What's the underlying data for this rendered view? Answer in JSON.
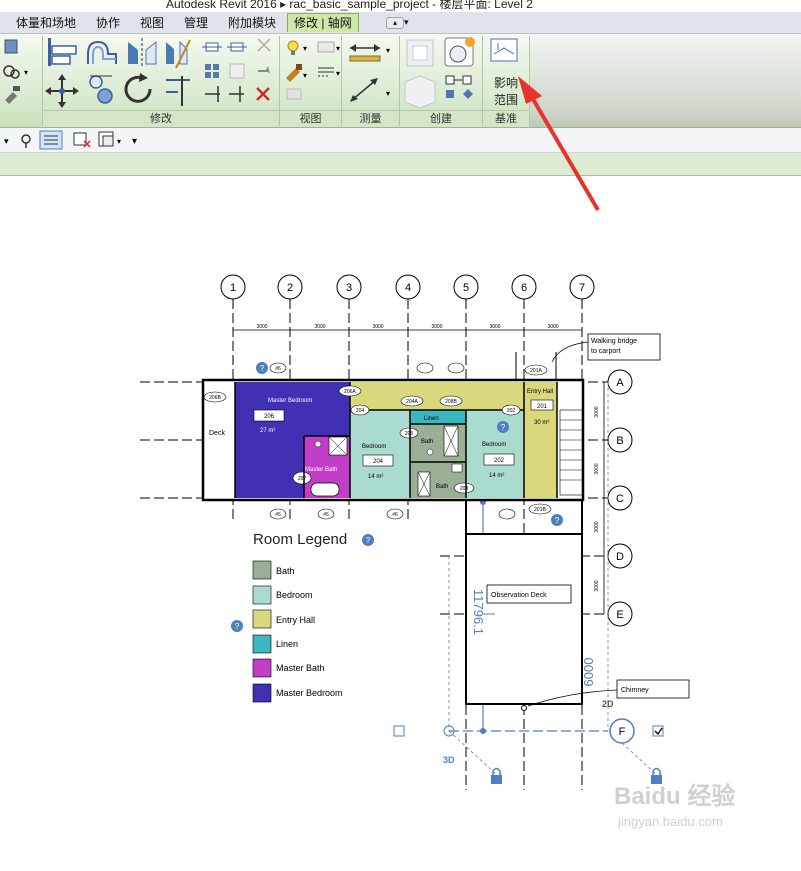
{
  "app": {
    "title": "Autodesk Revit 2016 ▸   rac_basic_sample_project - 楼层平面: Level 2"
  },
  "ribbon": {
    "tabs": [
      {
        "label": "体量和场地"
      },
      {
        "label": "协作"
      },
      {
        "label": "视图"
      },
      {
        "label": "管理"
      },
      {
        "label": "附加模块"
      },
      {
        "label": "修改 | 轴网"
      }
    ],
    "panels": {
      "modify": "修改",
      "view": "视图",
      "measure": "测量",
      "create": "创建",
      "datum": "基准"
    },
    "scope_box_label_line1": "影响",
    "scope_box_label_line2": "范围"
  },
  "plan": {
    "grid_columns": [
      "1",
      "2",
      "3",
      "4",
      "5",
      "6",
      "7"
    ],
    "grid_rows": [
      "A",
      "B",
      "C",
      "D",
      "E",
      "F"
    ],
    "spacing_h": [
      "3000",
      "3000",
      "3000",
      "3000",
      "3000",
      "3000"
    ],
    "spacing_v": [
      "3000",
      "3000",
      "3000",
      "3000"
    ],
    "dim_vertical": "11796.1",
    "dim_6000": "6000",
    "label_2d": "2D",
    "label_3d": "3D",
    "callouts": {
      "walking_bridge_line1": "Walking bridge",
      "walking_bridge_line2": "to carport",
      "chimney": "Chimney",
      "observation_deck": "Observation Deck"
    },
    "rooms": {
      "master_bedroom": {
        "name": "Master Bedroom",
        "number": "206",
        "area": "27 m²"
      },
      "master_bath": {
        "name": "Master Bath",
        "number": "207"
      },
      "bedroom_204": {
        "name": "Bedroom",
        "number": "204",
        "area": "14 m²"
      },
      "bedroom_202": {
        "name": "Bedroom",
        "number": "202",
        "area": "14 m²"
      },
      "bath": {
        "name": "Bath",
        "number": "205"
      },
      "bath2": {
        "name": "Bath",
        "number": "203"
      },
      "linen": {
        "name": "Linen"
      },
      "entry_hall": {
        "name": "Entry Hall",
        "number": "201",
        "area": "30 m²"
      },
      "deck": {
        "name": "Deck"
      }
    },
    "tags": [
      "206B",
      "206A",
      "204",
      "204A",
      "208B",
      "202",
      "201A",
      "201B"
    ],
    "section_marks": [
      "#6",
      "#6",
      "#6",
      "#6"
    ],
    "legend_title": "Room Legend",
    "legend": [
      {
        "name": "Bath",
        "color": "#9bae96"
      },
      {
        "name": "Bedroom",
        "color": "#a9dccf"
      },
      {
        "name": "Entry Hall",
        "color": "#d9d87d"
      },
      {
        "name": "Linen",
        "color": "#3ab7c0"
      },
      {
        "name": "Master Bath",
        "color": "#c23ec6"
      },
      {
        "name": "Master Bedroom",
        "color": "#4030b4"
      }
    ]
  },
  "watermark": {
    "brand": "Baidu 经验",
    "url": "jingyan.baidu.com"
  },
  "colors": {
    "ribbon_green": "#cfe8a8",
    "arrow_red": "#e8332a",
    "grid_blue": "#4f7fc0"
  }
}
